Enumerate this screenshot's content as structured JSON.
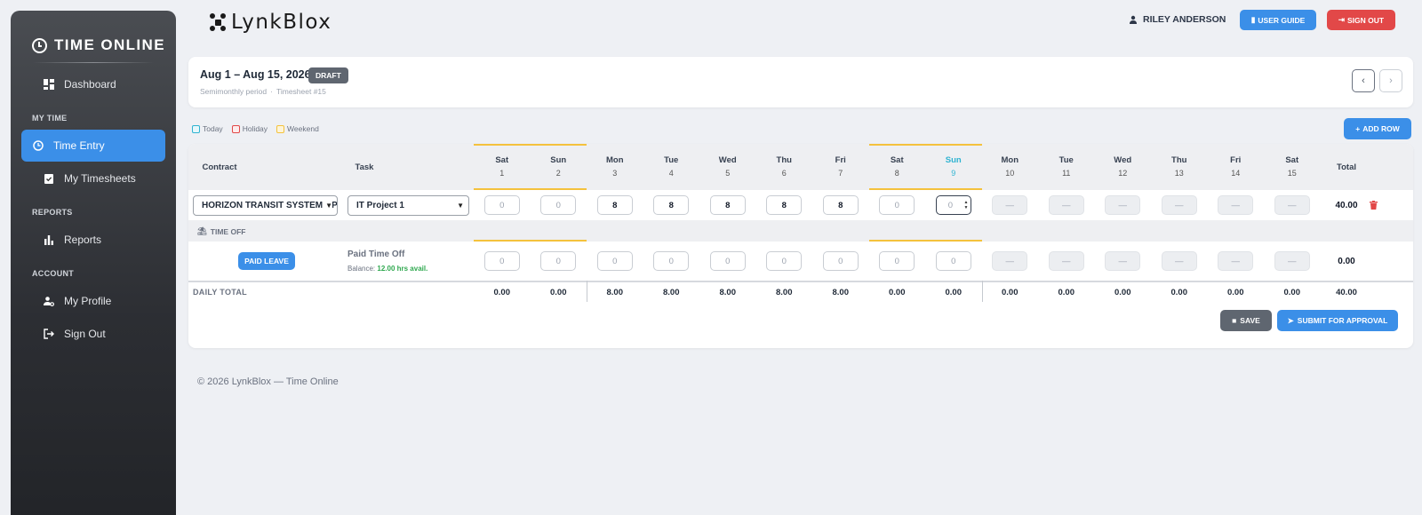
{
  "sidebar": {
    "title": "TIME ONLINE",
    "items": [
      {
        "label": "Dashboard",
        "icon": "dashboard-icon"
      },
      {
        "section": "MY TIME"
      },
      {
        "label": "Time Entry",
        "icon": "clock-icon",
        "active": true
      },
      {
        "label": "My Timesheets",
        "icon": "clipboard-check-icon"
      },
      {
        "section": "REPORTS"
      },
      {
        "label": "Reports",
        "icon": "bar-chart-icon"
      },
      {
        "section": "ACCOUNT"
      },
      {
        "label": "My Profile",
        "icon": "user-gear-icon"
      },
      {
        "label": "Sign Out",
        "icon": "sign-out-icon"
      }
    ]
  },
  "topbar": {
    "logo_text": "LynkBlox",
    "user_name": "RILEY ANDERSON",
    "guide_label": "USER GUIDE",
    "signout_label": "SIGN OUT"
  },
  "header": {
    "title": "Aug 1 – Aug 15, 2026",
    "status": "DRAFT",
    "period": "Semimonthly period",
    "timesheet": "Timesheet #15"
  },
  "legend": [
    "Today",
    "Holiday",
    "Weekend"
  ],
  "colors": {
    "accent": "#3b8fe8",
    "danger": "#e24848",
    "weekend": "#f4c23d",
    "today": "#2fb3d1",
    "holiday": "#e24848"
  },
  "add_row_label": "ADD ROW",
  "columns": {
    "contract": "Contract",
    "task": "Task",
    "total": "Total"
  },
  "days": [
    {
      "dow": "Sat",
      "num": "1",
      "weekend": true
    },
    {
      "dow": "Sun",
      "num": "2",
      "weekend": true
    },
    {
      "dow": "Mon",
      "num": "3"
    },
    {
      "dow": "Tue",
      "num": "4"
    },
    {
      "dow": "Wed",
      "num": "5"
    },
    {
      "dow": "Thu",
      "num": "6"
    },
    {
      "dow": "Fri",
      "num": "7"
    },
    {
      "dow": "Sat",
      "num": "8",
      "weekend": true
    },
    {
      "dow": "Sun",
      "num": "9",
      "weekend": true,
      "today": true
    },
    {
      "dow": "Mon",
      "num": "10",
      "future": true
    },
    {
      "dow": "Tue",
      "num": "11",
      "future": true
    },
    {
      "dow": "Wed",
      "num": "12",
      "future": true
    },
    {
      "dow": "Thu",
      "num": "13",
      "future": true
    },
    {
      "dow": "Fri",
      "num": "14",
      "future": true
    },
    {
      "dow": "Sat",
      "num": "15",
      "future": true
    }
  ],
  "entry_row": {
    "contract": "HORIZON TRANSIT SYSTEM UPGRADE",
    "task": "IT Project 1",
    "hours": [
      "0",
      "0",
      "8",
      "8",
      "8",
      "8",
      "8",
      "0",
      "0",
      "—",
      "—",
      "—",
      "—",
      "—",
      "—"
    ],
    "total": "40.00"
  },
  "time_off": {
    "section_label": "TIME OFF",
    "type_label": "PAID LEAVE",
    "name": "Paid Time Off",
    "balance_prefix": "Balance:",
    "balance_value": "12.00 hrs avail.",
    "hours": [
      "0",
      "0",
      "0",
      "0",
      "0",
      "0",
      "0",
      "0",
      "0",
      "—",
      "—",
      "—",
      "—",
      "—",
      "—"
    ],
    "total": "0.00"
  },
  "daily_total": {
    "label": "DAILY TOTAL",
    "values": [
      "0.00",
      "0.00",
      "8.00",
      "8.00",
      "8.00",
      "8.00",
      "8.00",
      "0.00",
      "0.00",
      "0.00",
      "0.00",
      "0.00",
      "0.00",
      "0.00",
      "0.00"
    ],
    "total": "40.00"
  },
  "save_label": "SAVE",
  "submit_label": "SUBMIT FOR APPROVAL",
  "footer": "© 2026 LynkBlox — Time Online"
}
